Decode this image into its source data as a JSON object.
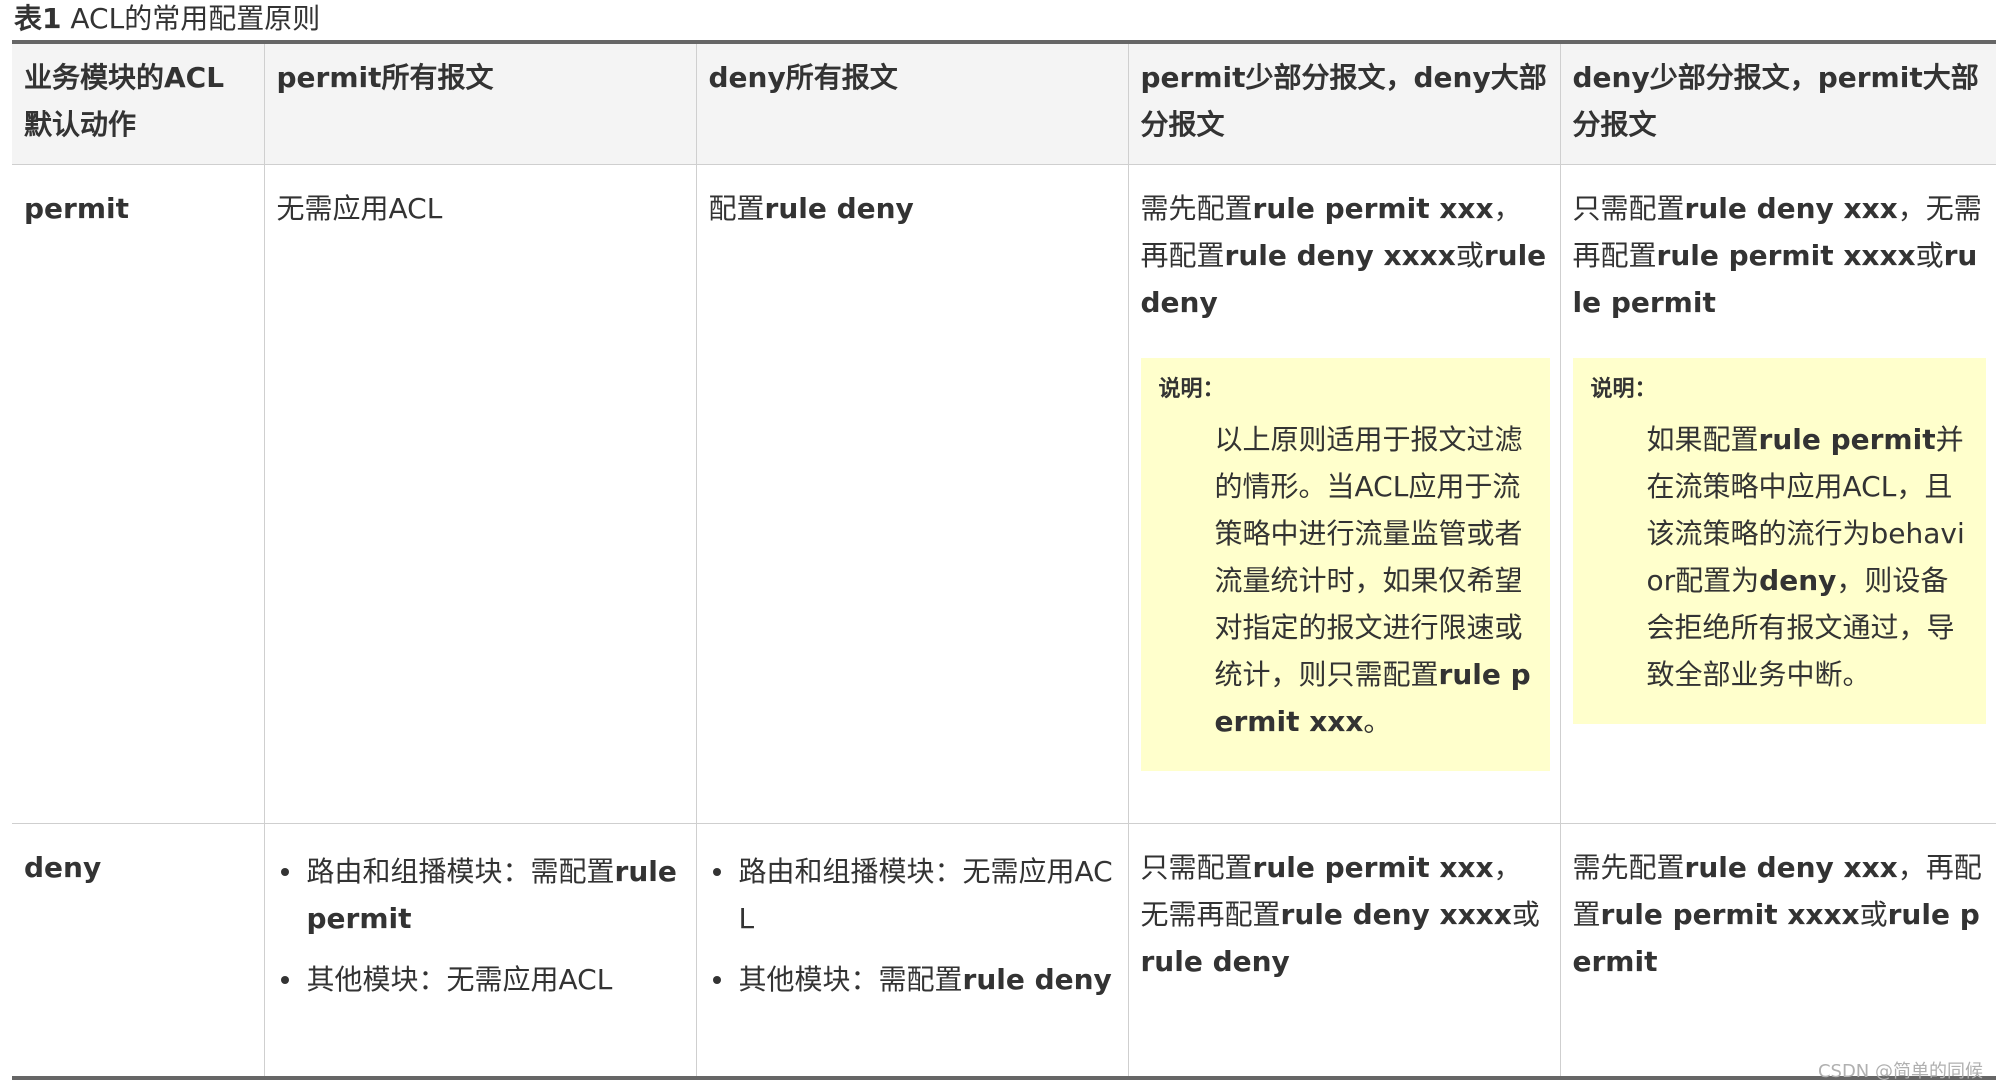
{
  "caption": {
    "label": "表1",
    "text": " ACL的常用配置原则"
  },
  "headers": [
    "业务模块的ACL默认动作",
    "permit所有报文",
    "deny所有报文",
    "permit少部分报文，deny大部分报文",
    "deny少部分报文，permit大部分报文"
  ],
  "row_permit": {
    "action": "permit",
    "c2": "无需应用ACL",
    "c3": {
      "a": "配置",
      "b": "rule deny"
    },
    "c4": {
      "a": "需先配置",
      "b": "rule permit xxx",
      "c": "，再配置",
      "d": "rule deny xxxx",
      "e": "或",
      "f": "rule deny"
    },
    "c5": {
      "a": "只需配置",
      "b": "rule deny xxx",
      "c": "，无需再配置",
      "d": "rule permit xxxx",
      "e": "或",
      "f": "rule permit"
    },
    "note4": {
      "title": "说明：",
      "a": "以上原则适用于报文过滤的情形。当ACL应用于流策略中进行流量监管或者流量统计时，如果仅希望对指定的报文进行限速或统计，则只需配置",
      "b": "rule permit xxx",
      "c": "。"
    },
    "note5": {
      "title": "说明：",
      "a": "如果配置",
      "b": "rule permit",
      "c": "并在流策略中应用ACL，且该流策略的流行为behavior配置为",
      "d": "deny",
      "e": "，则设备会拒绝所有报文通过，导致全部业务中断。"
    }
  },
  "row_deny": {
    "action": "deny",
    "c2": [
      {
        "a": "路由和组播模块：需配置",
        "b": "rule permit"
      },
      {
        "a": "其他模块：无需应用ACL",
        "b": ""
      }
    ],
    "c3": [
      {
        "a": "路由和组播模块：无需应用ACL",
        "b": ""
      },
      {
        "a": "其他模块：需配置",
        "b": "rule deny"
      }
    ],
    "c4": {
      "a": "只需配置",
      "b": "rule permit xxx",
      "c": "，无需再配置",
      "d": "rule deny xxxx",
      "e": "或",
      "f": "rule deny"
    },
    "c5": {
      "a": "需先配置",
      "b": "rule deny xxx",
      "c": "，再配置",
      "d": "rule permit xxxx",
      "e": "或",
      "f": "rule permit"
    }
  },
  "watermark": "CSDN @简单的同候"
}
